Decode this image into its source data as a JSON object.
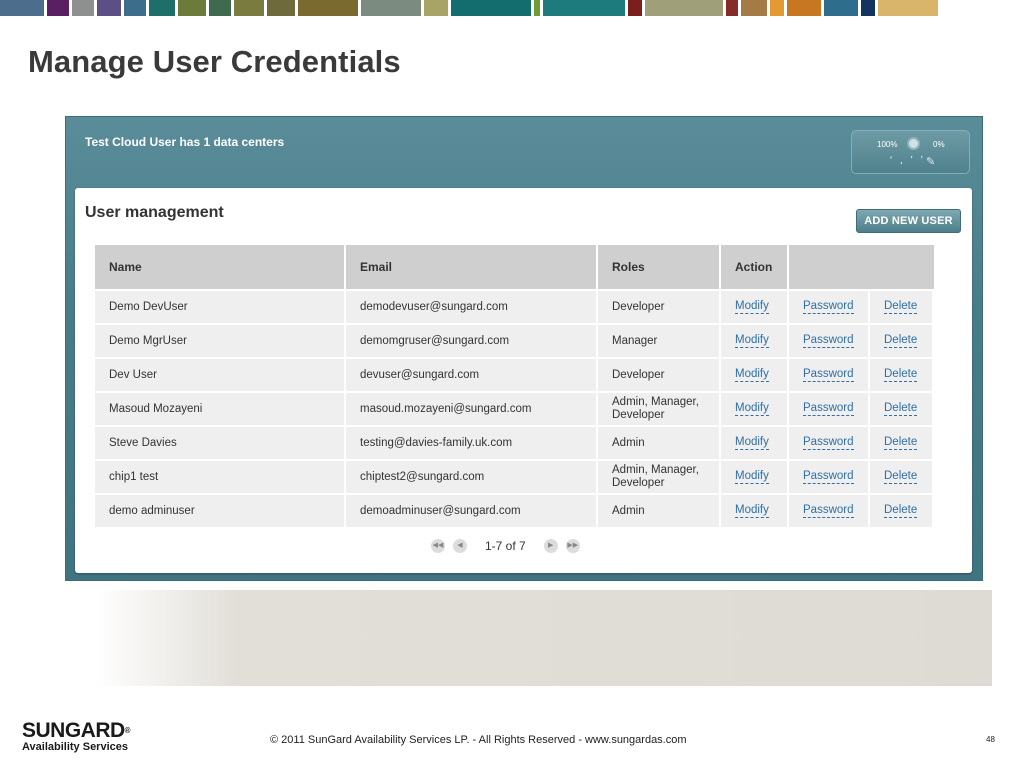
{
  "top_strip_colors": [
    "#4c6d8c",
    "#5a1f63",
    "#8e8f8f",
    "#5c4f86",
    "#3c6e8c",
    "#1e6f6a",
    "#6c7a3a",
    "#3e6a4f",
    "#7a7b3e",
    "#6e6a3b",
    "#7a6a2f",
    "#7c8b80",
    "#a8a366",
    "#136d6e",
    "#6f9a35",
    "#1d7b7d",
    "#7b1e1e",
    "#9fa07a",
    "#852b28",
    "#a47b44",
    "#e49a33",
    "#c77622",
    "#2f6d8c",
    "#12345f",
    "#d8b56a"
  ],
  "slide_title": "Manage User Credentials",
  "app": {
    "header_text": "Test Cloud User has 1 data centers",
    "meter": {
      "left_label": "100%",
      "right_label": "0%",
      "ticks": "' , ' '",
      "icon": "pencil-icon"
    }
  },
  "panel": {
    "title": "User management",
    "add_button_label": "ADD NEW USER"
  },
  "table": {
    "headers": {
      "name": "Name",
      "email": "Email",
      "roles": "Roles",
      "action": "Action"
    },
    "rows": [
      {
        "name": "Demo DevUser",
        "email": "demodevuser@sungard.com",
        "roles": "Developer",
        "modify": "Modify",
        "password": "Password",
        "delete": "Delete"
      },
      {
        "name": "Demo MgrUser",
        "email": "demomgruser@sungard.com",
        "roles": "Manager",
        "modify": "Modify",
        "password": "Password",
        "delete": "Delete"
      },
      {
        "name": "Dev User",
        "email": "devuser@sungard.com",
        "roles": "Developer",
        "modify": "Modify",
        "password": "Password",
        "delete": "Delete"
      },
      {
        "name": "Masoud Mozayeni",
        "email": "masoud.mozayeni@sungard.com",
        "roles": "Admin, Manager, Developer",
        "modify": "Modify",
        "password": "Password",
        "delete": "Delete"
      },
      {
        "name": "Steve Davies",
        "email": "testing@davies-family.uk.com",
        "roles": "Admin",
        "modify": "Modify",
        "password": "Password",
        "delete": "Delete"
      },
      {
        "name": "chip1 test",
        "email": "chiptest2@sungard.com",
        "roles": "Admin, Manager, Developer",
        "modify": "Modify",
        "password": "Password",
        "delete": "Delete"
      },
      {
        "name": "demo adminuser",
        "email": "demoadminuser@sungard.com",
        "roles": "Admin",
        "modify": "Modify",
        "password": "Password",
        "delete": "Delete"
      }
    ]
  },
  "pager": {
    "text": "1-7 of 7",
    "first_icon": "first-page-icon",
    "prev_icon": "prev-page-icon",
    "next_icon": "next-page-icon",
    "last_icon": "last-page-icon"
  },
  "footer": {
    "logo_main": "SUNGARD",
    "logo_reg": "®",
    "logo_sub": "Availability Services",
    "copyright": "© 2011 SunGard Availability Services LP. - All Rights Reserved - www.sungardas.com",
    "page_number": "48"
  }
}
